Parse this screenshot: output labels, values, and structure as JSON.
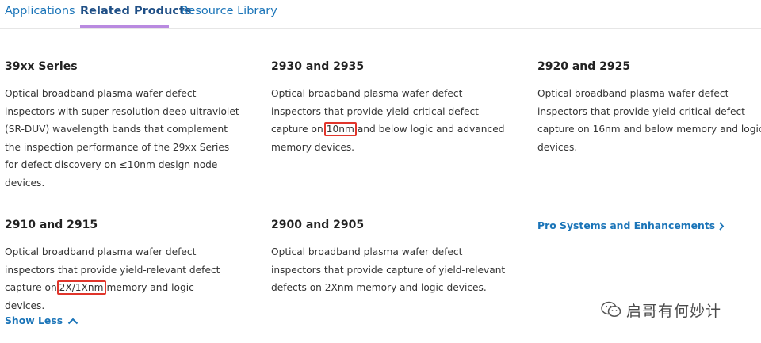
{
  "tabs": [
    {
      "label": "Applications"
    },
    {
      "label": "Related Products"
    },
    {
      "label": "Resource Library"
    }
  ],
  "products": [
    {
      "title": "39xx Series",
      "description": "Optical broadband plasma wafer defect inspectors with super resolution deep ultraviolet (SR-DUV) wavelength bands that complement the inspection performance of the 29xx Series for defect discovery on ≤10nm design node devices."
    },
    {
      "title": "2930 and 2935",
      "desc_pre": "Optical broadband plasma wafer defect inspectors that provide yield-critical defect capture on",
      "desc_highlight": "10nm",
      "desc_post": "and below logic and advanced memory devices."
    },
    {
      "title": "2920 and 2925",
      "description": "Optical broadband plasma wafer defect inspectors that provide yield-critical defect capture on 16nm and below memory and logic devices."
    },
    {
      "title": "2910 and 2915",
      "desc_pre": "Optical broadband plasma wafer defect inspectors that provide yield-relevant defect capture on",
      "desc_highlight": "2X/1Xnm",
      "desc_post": "memory and logic devices."
    },
    {
      "title": "2900 and 2905",
      "description": "Optical broadband plasma wafer defect inspectors that provide capture of yield-relevant defects on 2Xnm memory and logic devices."
    }
  ],
  "links": {
    "pro_systems": "Pro Systems and Enhancements",
    "show_less": "Show Less"
  },
  "watermark": {
    "text": "启哥有何妙计",
    "icon": "wechat-icon"
  },
  "colors": {
    "link": "#1a74b8",
    "tab_underline": "#b98ae0",
    "highlight_box": "#e0352b"
  }
}
